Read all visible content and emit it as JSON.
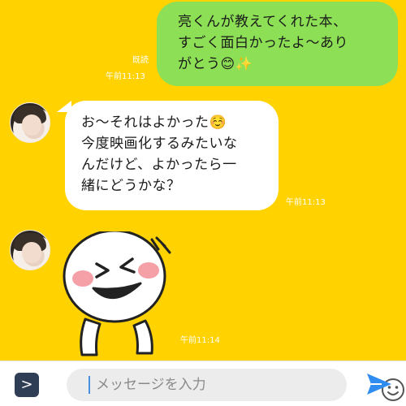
{
  "chat": {
    "background": "#FFD200",
    "messages": [
      {
        "type": "sent",
        "lines": [
          "亮くんが教えてくれた本、",
          "すごく面白かったよ〜あり",
          "がとう😊✨"
        ],
        "read_label": "既読",
        "time": "午前11:13"
      },
      {
        "type": "received",
        "lines": [
          "お〜それはよかった☺️",
          "今度映画化するみたいな",
          "んだけど、よかったら一",
          "緒にどうかな？"
        ],
        "time": "午前11:13"
      },
      {
        "type": "sticker",
        "sticker": "laughing-face-sticker",
        "time": "午前11:14"
      }
    ]
  },
  "input_bar": {
    "expand_icon": ">",
    "placeholder": "メッセージを入力",
    "emoji_icon": "smiley-icon",
    "send_icon": "send-icon"
  },
  "colors": {
    "sent_bubble": "#8DE055",
    "received_bubble": "#FFFFFF",
    "accent": "#2f8cf0"
  }
}
